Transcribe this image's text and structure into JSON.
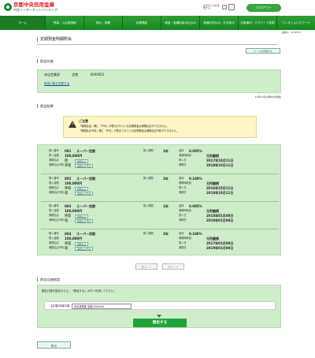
{
  "header": {
    "bank_name": "京都中央信用金庫",
    "bank_sub": "中信インターネットバンキング",
    "font_size_label": "文字サイズを変更する",
    "logout_label": "ログアウト"
  },
  "nav": [
    {
      "label": "ホーム"
    },
    {
      "label": "残高・入出金明細"
    },
    {
      "label": "振込・振替"
    },
    {
      "label": "定期預金"
    },
    {
      "label": "税金・各種料金の払込み"
    },
    {
      "label": "各種お申込み・お手続き"
    },
    {
      "label": "お客様ID・パスワード変更"
    },
    {
      "label": "ワンタイムパスワード"
    }
  ],
  "screen_id": "画面ID：BTM003",
  "page_title": "定期預金明細照会",
  "print_button": "ページを印刷する",
  "account_section": {
    "title": "照会口座",
    "branch": "本店営業部",
    "type": "定期",
    "number": "0000001",
    "change_link": "照会口座を変更する"
  },
  "timestamp": "10月10日10時00分現在",
  "results_section": {
    "title": "照会結果",
    "notice_title": "ご注意",
    "notice_line1": "「満期払戻」欄に「不可」が表示されている定期預金は満期払戻ができません。",
    "notice_line2": "「満期払戻予約」欄に「不可」が表示されている定期預金は満期払戻予約ができません。",
    "entries": [
      {
        "no_label": "預入番号",
        "no": "001",
        "product": "スーパー定期",
        "amount_label": "預入金額",
        "amount": "100,000円",
        "period_label": "預入期間",
        "period": "1年",
        "rate_label": "金利",
        "rate": "0.085%",
        "r1_label": "満期払戻",
        "r1_val": "可",
        "r1_btn": "満期払戻",
        "r2_label": "満期払戻予約",
        "r2_val": "不可",
        "r2_btn": "満期払戻予約",
        "k1_label": "満期時取扱",
        "k1_val": "元利継続",
        "k2_label": "預入日",
        "k2_val": "2017年10月11日",
        "k3_label": "満期日",
        "k3_val": "2018年10月11日"
      },
      {
        "no_label": "預入番号",
        "no": "002",
        "product": "スーパー定期",
        "amount_label": "預入金額",
        "amount": "100,000円",
        "period_label": "預入期間",
        "period": "2年",
        "rate_label": "金利",
        "rate": "0.100%",
        "r1_label": "満期払戻",
        "r1_val": "不可",
        "r1_btn": "満期払戻",
        "r2_label": "満期払戻予約",
        "r2_val": "可",
        "r2_btn": "満期払戻予約",
        "k1_label": "満期時取扱",
        "k1_val": "元利継続",
        "k2_label": "預入日",
        "k2_val": "2016年10月11日",
        "k3_label": "満期日",
        "k3_val": "2018年10月11日"
      },
      {
        "no_label": "預入番号",
        "no": "003",
        "product": "スーパー定期",
        "amount_label": "預入金額",
        "amount": "100,000円",
        "period_label": "預入期間",
        "period": "1年",
        "rate_label": "金利",
        "rate": "0.085%",
        "r1_label": "満期払戻",
        "r1_val": "不可",
        "r1_btn": "満期払戻",
        "r2_label": "満期払戻予約",
        "r2_val": "可",
        "r2_btn": "満期払戻予約",
        "k1_label": "満期時取扱",
        "k1_val": "元利継続",
        "k2_label": "預入日",
        "k2_val": "2018年01月08日",
        "k3_label": "満期日",
        "k3_val": "2019年01月08日"
      },
      {
        "no_label": "預入番号",
        "no": "004",
        "product": "スーパー定期",
        "amount_label": "預入金額",
        "amount": "100,000円",
        "period_label": "預入期間",
        "period": "2年",
        "rate_label": "金利",
        "rate": "0.100%",
        "r1_label": "満期払戻",
        "r1_val": "不可",
        "r1_btn": "満期払戻",
        "r2_label": "満期払戻予約",
        "r2_val": "可",
        "r2_btn": "満期払戻予約",
        "k1_label": "満期時取扱",
        "k1_val": "元利継続",
        "k2_label": "預入日",
        "k2_val": "2017年01月08日",
        "k3_label": "満期日",
        "k3_val": "2019年01月08日"
      }
    ]
  },
  "pager": {
    "prev": "前ページ",
    "next": "次ページ"
  },
  "spec_section": {
    "title": "照会口座指定",
    "note": "照会口座を指定のうえ、「照会する」ボタンを押して下さい。",
    "required": "【必須】",
    "label": "対象口座",
    "selected": "本店営業部 定期 0000001",
    "submit": "照会する"
  },
  "back_button": "戻る",
  "colors": {
    "brand_green": "#22a33a",
    "panel_green": "#cfeccb",
    "notice_yellow": "#fff6c6",
    "bank_red": "#dd2222"
  }
}
